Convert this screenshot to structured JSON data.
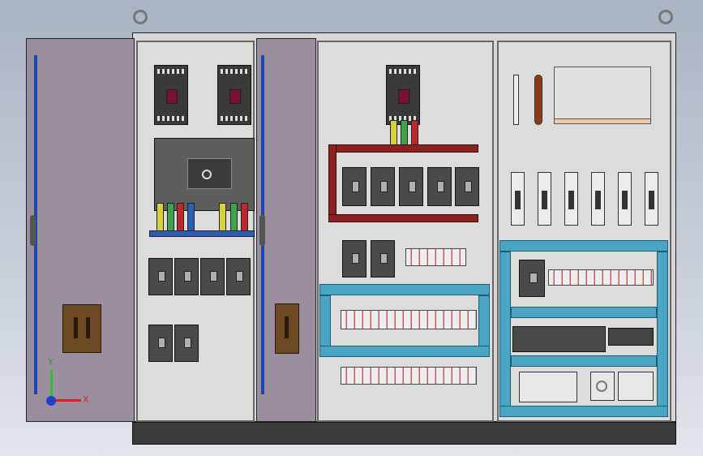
{
  "scene": {
    "title": "",
    "axis_labels": {
      "x": "X",
      "y": "Y"
    }
  },
  "colors": {
    "background_top": "#a9b4c4",
    "background_bottom": "#e2e6ec",
    "door": "#9b8f9f",
    "bus_red": "#c0262b",
    "bus_yellow": "#d7d13a",
    "bus_green": "#3fa34a",
    "bus_blue": "#2c5fb3",
    "tray_blue": "#4aa6c4"
  },
  "icons": {
    "axis": "xyz-axis-icon",
    "lifting_eye": "lifting-eye-icon"
  }
}
